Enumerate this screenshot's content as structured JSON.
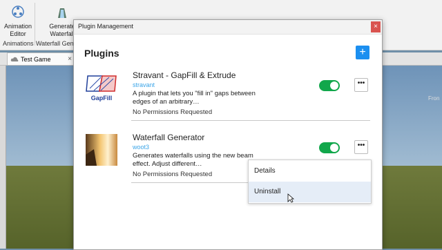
{
  "ribbon": {
    "buttons": [
      {
        "label_line1": "Animation",
        "label_line2": "Editor",
        "icon": "animation-editor-icon"
      },
      {
        "label_line1": "Generate",
        "label_line2": "Waterfall",
        "icon": "waterfall-icon"
      }
    ],
    "groups": [
      "Animations",
      "Waterfall Gene"
    ]
  },
  "doc_tab": {
    "label": "Test Game",
    "close": "×"
  },
  "viewport": {
    "front_label": "Fron"
  },
  "dialog": {
    "title": "Plugin Management",
    "close": "×",
    "heading": "Plugins",
    "add": "+",
    "plugins": [
      {
        "name": "Stravant - GapFill & Extrude",
        "author": "stravant",
        "description": "A plugin that lets you \"fill in\" gaps between edges of an arbitrary…",
        "permissions": "No Permissions Requested",
        "enabled": true,
        "thumb_label": "GapFill"
      },
      {
        "name": "Waterfall Generator",
        "author": "woot3",
        "description": "Generates waterfalls using the new beam effect. Adjust different…",
        "permissions": "No Permissions Requested",
        "enabled": true
      }
    ],
    "more": "•••",
    "menu": {
      "items": [
        "Details",
        "Uninstall"
      ]
    }
  },
  "colors": {
    "accent": "#1b8ff0",
    "toggle_on": "#11a74b",
    "close": "#d9534f",
    "author": "#3ba5e8"
  }
}
